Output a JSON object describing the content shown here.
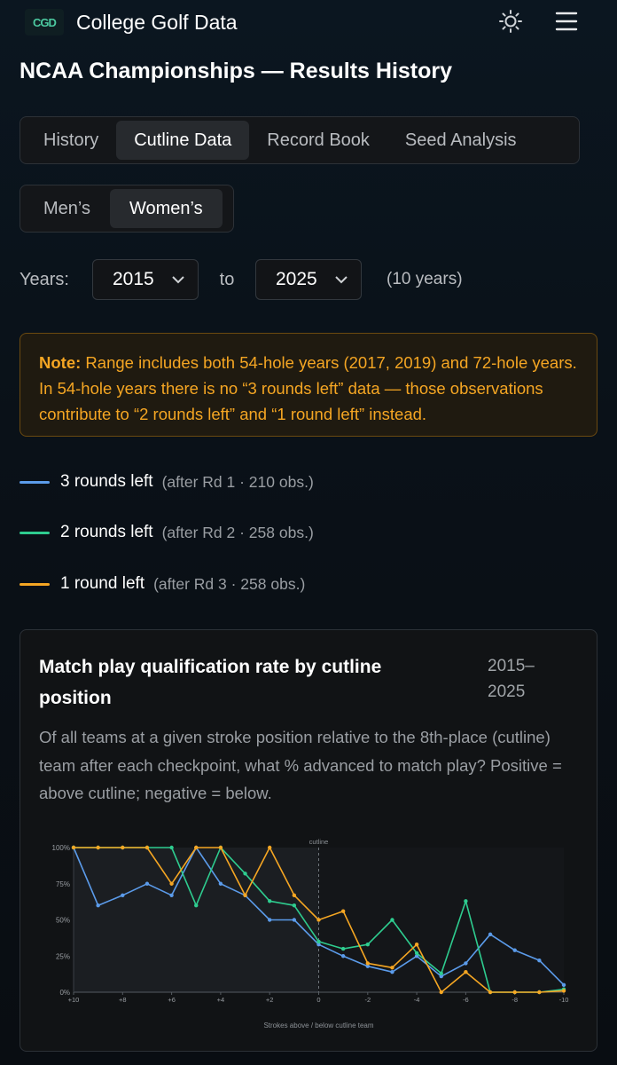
{
  "app": {
    "title": "College Golf Data",
    "logo_text": "CGD"
  },
  "header": {
    "theme_icon": "sun-icon",
    "menu_icon": "hamburger-menu-icon"
  },
  "page_title": "NCAA Championships — Results History",
  "tabs": [
    {
      "label": "History",
      "active": false
    },
    {
      "label": "Cutline Data",
      "active": true
    },
    {
      "label": "Record Book",
      "active": false
    },
    {
      "label": "Seed Analysis",
      "active": false
    }
  ],
  "gender": [
    {
      "label": "Men’s",
      "active": false
    },
    {
      "label": "Women’s",
      "active": true
    }
  ],
  "years": {
    "label": "Years:",
    "from": "2015",
    "to_label": "to",
    "to": "2025",
    "count": "(10 years)"
  },
  "note": {
    "bold": "Note:",
    "text": " Range includes both 54-hole years (2017, 2019) and 72-hole years. In 54-hole years there is no “3 rounds left” data — those observations contribute to “2 rounds left” and “1 round left” instead."
  },
  "legend": [
    {
      "label": "3 rounds left",
      "sub": "(after Rd 1 · 210 obs.)",
      "color": "#5b9bea"
    },
    {
      "label": "2 rounds left",
      "sub": "(after Rd 2 · 258 obs.)",
      "color": "#2ecc8f"
    },
    {
      "label": "1 round left",
      "sub": "(after Rd 3 · 258 obs.)",
      "color": "#f5a623"
    }
  ],
  "card": {
    "title": "Match play qualification rate by cutline position",
    "years": "2015–2025",
    "description": "Of all teams at a given stroke position relative to the 8th-place (cutline) team after each checkpoint, what % advanced to match play? Positive = above cutline; negative = below."
  },
  "chart_data": {
    "type": "line",
    "title": "Match play qualification rate by cutline position",
    "xlabel": "Strokes above / below cutline team",
    "ylabel": "",
    "x": [
      10,
      9,
      8,
      7,
      6,
      5,
      4,
      3,
      2,
      1,
      0,
      -1,
      -2,
      -3,
      -4,
      -5,
      -6,
      -7,
      -8,
      -9,
      -10
    ],
    "x_tick_labels": [
      "+10",
      "+8",
      "+6",
      "+4",
      "+2",
      "0",
      "-2",
      "-4",
      "-6",
      "-8",
      "-10"
    ],
    "y_tick_labels": [
      "0%",
      "25%",
      "50%",
      "75%",
      "100%"
    ],
    "ylim": [
      0,
      100
    ],
    "cutline_label": "cutline",
    "grid": false,
    "series": [
      {
        "name": "3 rounds left",
        "color": "#5b9bea",
        "values": [
          100,
          60,
          67,
          75,
          67,
          100,
          75,
          67,
          50,
          50,
          33,
          25,
          18,
          14,
          25,
          11,
          20,
          40,
          29,
          22,
          5
        ]
      },
      {
        "name": "2 rounds left",
        "color": "#2ecc8f",
        "values": [
          100,
          100,
          100,
          100,
          100,
          60,
          100,
          82,
          63,
          60,
          35,
          30,
          33,
          50,
          27,
          13,
          63,
          0,
          0,
          0,
          2
        ]
      },
      {
        "name": "1 round left",
        "color": "#f5a623",
        "values": [
          100,
          100,
          100,
          100,
          75,
          100,
          100,
          67,
          100,
          67,
          50,
          56,
          20,
          17,
          33,
          0,
          14,
          0,
          0,
          0,
          1
        ]
      }
    ]
  }
}
